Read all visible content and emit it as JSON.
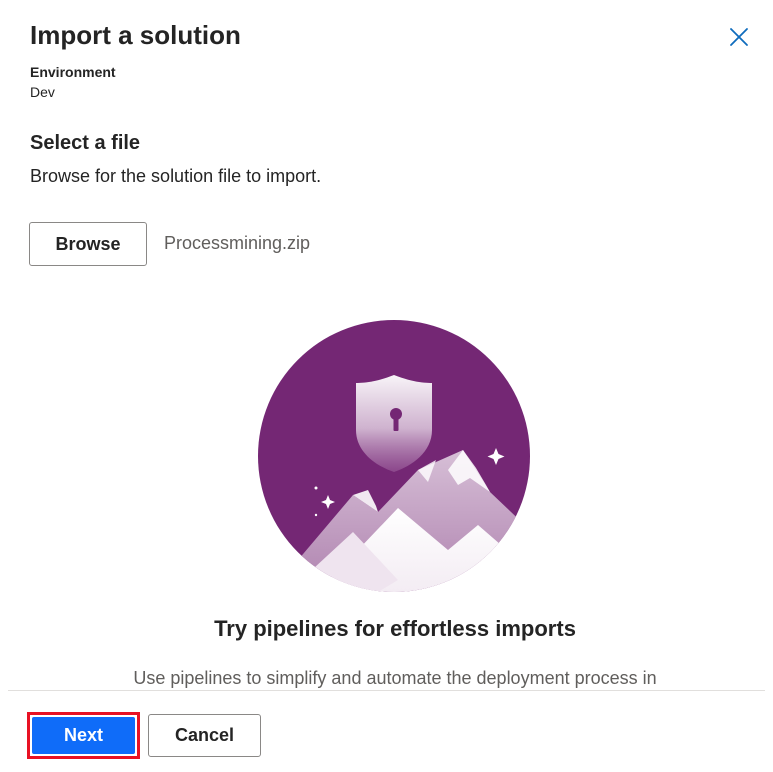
{
  "dialog": {
    "title": "Import a solution",
    "close_icon": "close-icon"
  },
  "environment": {
    "label": "Environment",
    "value": "Dev"
  },
  "select_file": {
    "title": "Select a file",
    "description": "Browse for the solution file to import.",
    "browse_label": "Browse",
    "file_name": "Processmining.zip"
  },
  "promo": {
    "illustration_icon": "shield-mountains-illustration",
    "title": "Try pipelines for effortless imports",
    "description": "Use pipelines to simplify and automate the deployment process in"
  },
  "footer": {
    "next_label": "Next",
    "cancel_label": "Cancel"
  },
  "colors": {
    "primary": "#0f6cf9",
    "highlight": "#e81123",
    "illustration_purple": "#742774"
  }
}
